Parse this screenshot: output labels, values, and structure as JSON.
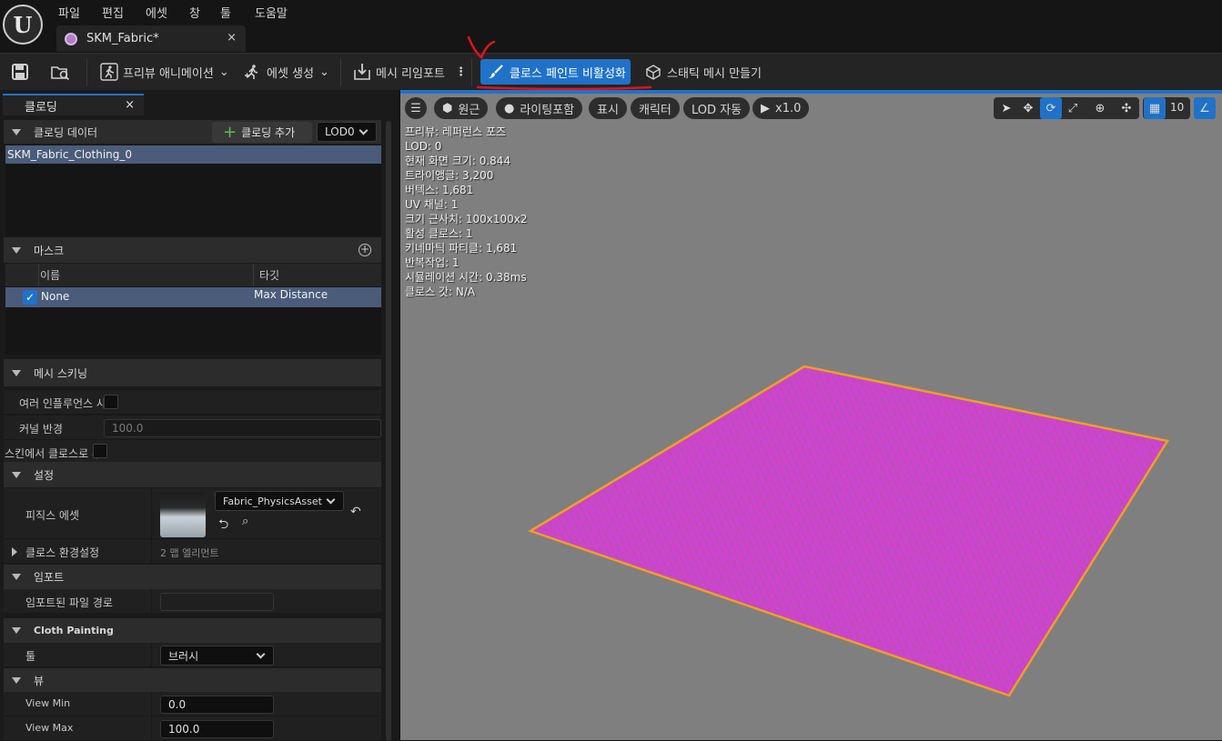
{
  "app": {
    "logo_glyph": "U"
  },
  "menu": {
    "items": [
      "파일",
      "편집",
      "에셋",
      "창",
      "툴",
      "도움말"
    ]
  },
  "tab": {
    "title": "SKM_Fabric*",
    "close": "×"
  },
  "toolbar": {
    "preview_anim_label": "프리뷰 애니메이션",
    "create_asset_label": "에셋 생성",
    "reimport_label": "메시 리임포트",
    "cloth_paint_label": "클로스 페인트 비활성화",
    "static_mesh_label": "스태틱 메시 만들기"
  },
  "left_panel": {
    "tab_title": "클로딩",
    "tab_close": "×",
    "clothing_data": {
      "header": "클로딩 데이터",
      "add_label": "클로딩 추가",
      "lod_value": "LOD0",
      "items": [
        "SKM_Fabric_Clothing_0"
      ]
    },
    "mask": {
      "header": "마스크",
      "col_name": "이름",
      "col_target": "타깃",
      "rows": [
        {
          "name": "None",
          "target": "Max Distance",
          "checked": true
        }
      ]
    },
    "mesh_skinning": {
      "header": "메시 스키닝",
      "multi_influence_label": "여러 인플루언스 사",
      "kernel_radius_label": "커널 반경",
      "kernel_radius_value": "100.0",
      "skin_to_cloth_label": "스킨에서 클로스로 부"
    },
    "settings": {
      "header": "설정",
      "physics_asset_label": "피직스 에셋",
      "physics_asset_value": "Fabric_PhysicsAsset",
      "cloth_config_label": "클로스 환경설정",
      "cloth_config_value": "2 맵 엘리먼트"
    },
    "import": {
      "header": "임포트",
      "path_label": "임포트된 파일 경로",
      "path_value": ""
    },
    "cloth_painting": {
      "header": "Cloth Painting",
      "tool_label": "툴",
      "tool_value": "브러시"
    },
    "view": {
      "header": "뷰",
      "min_label": "View Min",
      "min_value": "0.0",
      "max_label": "View Max",
      "max_value": "100.0"
    }
  },
  "viewport": {
    "buttons": {
      "perspective": "원근",
      "lighting": "라이팅포함",
      "show": "표시",
      "character": "캐릭터",
      "lod": "LOD 자동",
      "speed": "x1.0",
      "grid_size": "10"
    },
    "stats": [
      "프리뷰: 레퍼런스 포즈",
      "LOD: 0",
      "현재 화면 크기: 0.844",
      "트라이앵글: 3,200",
      "버텍스: 1,681",
      "UV 채널: 1",
      "크기 근사치: 100x100x2",
      "활성 클로스: 1",
      "키네마틱 파티클: 1,681",
      "반복작업: 1",
      "시뮬레이션 시간: 0.38ms",
      "클로스 갓: N/A"
    ]
  },
  "colors": {
    "accent": "#1f72c8",
    "cloth_fill": "#d63fd6",
    "cloth_outline": "#f0a020",
    "annotation": "#e0141e"
  }
}
